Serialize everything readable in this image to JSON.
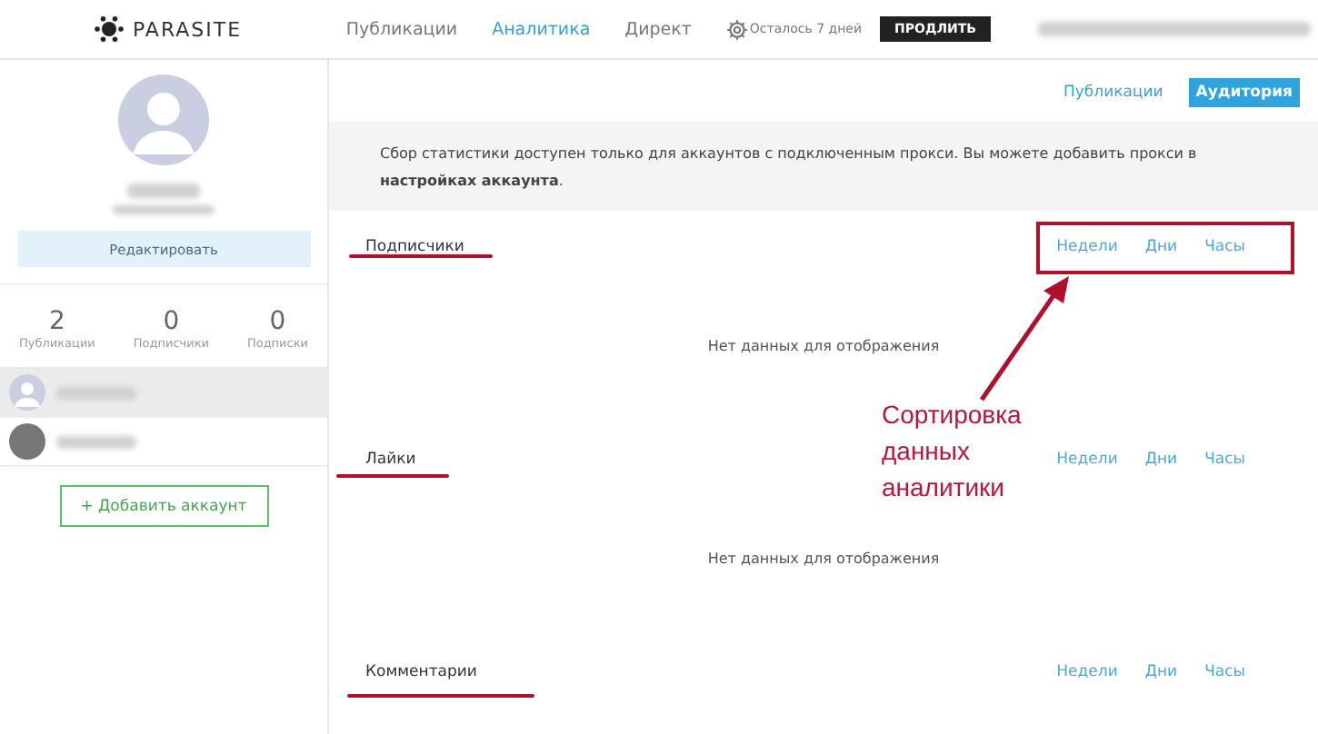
{
  "header": {
    "logo": "PARASITE",
    "nav": [
      {
        "label": "Публикации",
        "selected": false
      },
      {
        "label": "Аналитика",
        "selected": true
      },
      {
        "label": "Директ",
        "selected": false
      }
    ],
    "trial": "Осталось 7 дней",
    "extend_button": "ПРОДЛИТЬ"
  },
  "sidebar": {
    "edit_button": "Редактировать",
    "stats": [
      {
        "value": "2",
        "label": "Публикации"
      },
      {
        "value": "0",
        "label": "Подписчики"
      },
      {
        "value": "0",
        "label": "Подписки"
      }
    ],
    "accounts": [
      {
        "kind": "default",
        "selected": true
      },
      {
        "kind": "photo",
        "selected": false
      }
    ],
    "add_button": "+ Добавить аккаунт"
  },
  "main": {
    "tabs": [
      {
        "label": "Публикации",
        "selected": false
      },
      {
        "label": "Аудитория",
        "selected": true
      }
    ],
    "notice": "Сбор статистики доступен только для аккаунтов с подключенным прокси. Вы можете добавить прокси в **настройках аккаунта**.",
    "sections": [
      {
        "title": "Подписчики",
        "periods": [
          "Недели",
          "Дни",
          "Часы"
        ],
        "empty": "Нет данных для отображения"
      },
      {
        "title": "Лайки",
        "periods": [
          "Недели",
          "Дни",
          "Часы"
        ],
        "empty": "Нет данных для отображения"
      },
      {
        "title": "Комментарии",
        "periods": [
          "Недели",
          "Дни",
          "Часы"
        ]
      }
    ]
  },
  "annotation": {
    "text": "Сортировка данных аналитики"
  }
}
